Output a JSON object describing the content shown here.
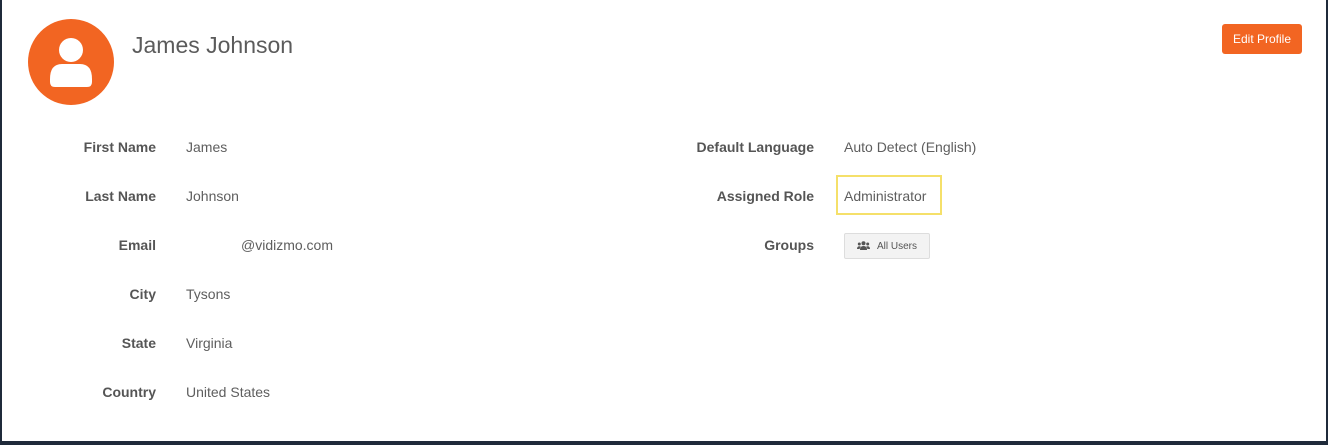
{
  "profile": {
    "name": "James Johnson",
    "edit_button": "Edit Profile"
  },
  "details_left": [
    {
      "label": "First Name",
      "value": "James"
    },
    {
      "label": "Last Name",
      "value": "Johnson"
    },
    {
      "label": "Email",
      "value": "@vidizmo.com"
    },
    {
      "label": "City",
      "value": "Tysons"
    },
    {
      "label": "State",
      "value": "Virginia"
    },
    {
      "label": "Country",
      "value": "United States"
    }
  ],
  "details_right": [
    {
      "label": "Default Language",
      "value": "Auto Detect (English)"
    },
    {
      "label": "Assigned Role",
      "value": "Administrator"
    },
    {
      "label": "Groups",
      "chip": "All Users"
    }
  ],
  "icons": {
    "avatar": "user-avatar-icon",
    "group": "users-group-icon"
  },
  "colors": {
    "accent": "#f26522",
    "highlight": "#f5e06a"
  }
}
